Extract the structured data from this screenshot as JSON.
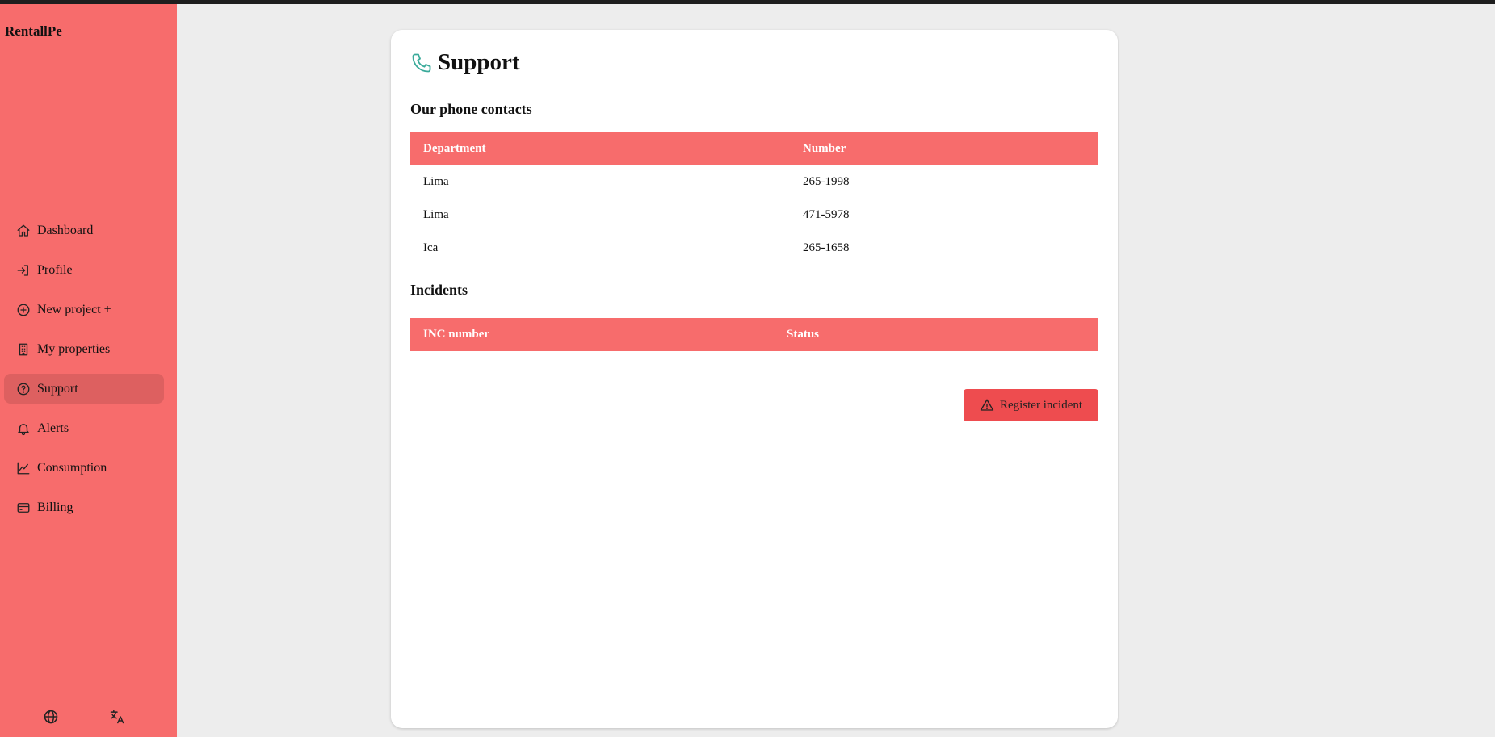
{
  "app": {
    "brand": "RentallPe"
  },
  "sidebar": {
    "items": [
      {
        "label": "Dashboard",
        "icon": "home-icon"
      },
      {
        "label": "Profile",
        "icon": "login-icon"
      },
      {
        "label": "New project +",
        "icon": "plus-circle-icon"
      },
      {
        "label": "My properties",
        "icon": "building-icon"
      },
      {
        "label": "Support",
        "icon": "help-circle-icon",
        "active": true
      },
      {
        "label": "Alerts",
        "icon": "bell-icon"
      },
      {
        "label": "Consumption",
        "icon": "chart-line-icon"
      },
      {
        "label": "Billing",
        "icon": "credit-card-icon"
      }
    ],
    "bottom_icons": [
      "globe-icon",
      "language-icon"
    ]
  },
  "page": {
    "title": "Support",
    "title_icon": "phone-icon",
    "phone_section": {
      "title": "Our phone contacts",
      "columns": [
        "Department",
        "Number"
      ],
      "rows": [
        [
          "Lima",
          "265-1998"
        ],
        [
          "Lima",
          "471-5978"
        ],
        [
          "Ica",
          "265-1658"
        ]
      ]
    },
    "incidents_section": {
      "title": "Incidents",
      "columns": [
        "INC number",
        "Status"
      ],
      "rows": []
    },
    "register_button": {
      "label": "Register incident",
      "icon": "alert-triangle-icon"
    }
  },
  "colors": {
    "sidebar": "#f76c6c",
    "active_item": "#dd6060",
    "table_header": "#f76c6c",
    "button": "#ee4c4f",
    "phone_icon": "#3aaa9a",
    "background": "#ededed"
  }
}
